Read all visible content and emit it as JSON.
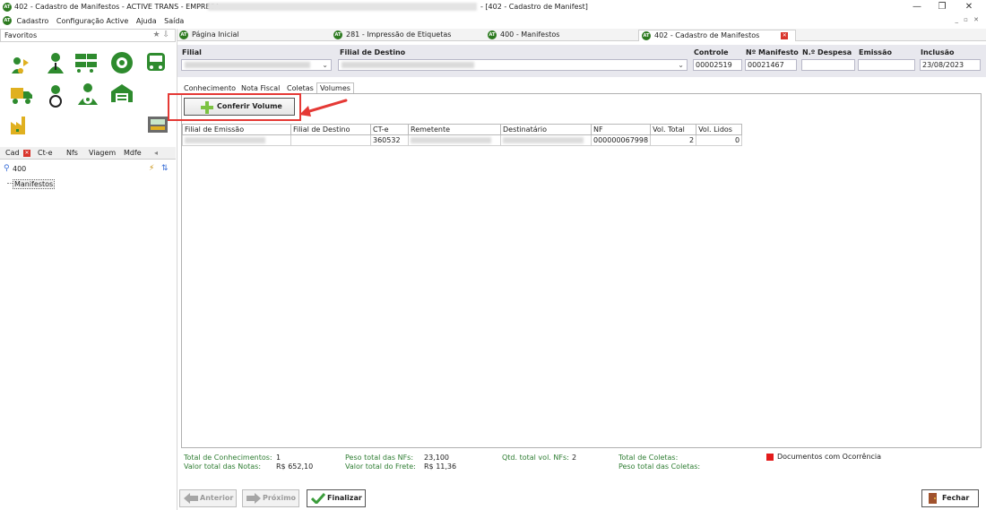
{
  "window": {
    "title_left": "402 - Cadastro de Manifestos - ACTIVE TRANS - EMPRESA:",
    "title_right": "- [402 - Cadastro de Manifest]"
  },
  "menu": {
    "items": [
      "Cadastro",
      "Configuração Active",
      "Ajuda",
      "Saída"
    ]
  },
  "left_panel": {
    "favorites_label": "Favoritos",
    "tabs": [
      "Cad",
      "Ct-e",
      "Nfs",
      "Viagem",
      "Mdfe"
    ],
    "search_value": "400",
    "tree_node": "Manifestos"
  },
  "doc_tabs": [
    {
      "label": "Página Inicial"
    },
    {
      "label": "281 - Impressão de Etiquetas"
    },
    {
      "label": "400 - Manifestos"
    },
    {
      "label": "402 - Cadastro de Manifestos"
    }
  ],
  "header": {
    "filial_label": "Filial",
    "filial_destino_label": "Filial de Destino",
    "controle_label": "Controle",
    "controle_value": "00002519",
    "manifesto_label": "Nº Manifesto",
    "manifesto_value": "00021467",
    "despesa_label": "N.º Despesa",
    "despesa_value": "",
    "emissao_label": "Emissão",
    "emissao_value": "",
    "inclusao_label": "Inclusão",
    "inclusao_value": "23/08/2023"
  },
  "inner_tabs": [
    "Conhecimento",
    "Nota Fiscal",
    "Coletas",
    "Volumes"
  ],
  "conferir_button": "Conferir Volume",
  "grid": {
    "columns": [
      "Filial de Emissão",
      "Filial de Destino",
      "CT-e",
      "Remetente",
      "Destinatário",
      "NF",
      "Vol. Total",
      "Vol. Lidos"
    ],
    "rows": [
      {
        "cte": "360532",
        "nf": "000000067998",
        "vol_total": "2",
        "vol_lidos": "0"
      }
    ]
  },
  "totals": {
    "conhecimentos_label": "Total de Conhecimentos:",
    "conhecimentos_value": "1",
    "valor_notas_label": "Valor total das Notas:",
    "valor_notas_value": "R$ 652,10",
    "peso_nfs_label": "Peso total das NFs:",
    "peso_nfs_value": "23,100",
    "valor_frete_label": "Valor total do Frete:",
    "valor_frete_value": "R$ 11,36",
    "qtd_vol_label": "Qtd. total vol. NFs:",
    "qtd_vol_value": "2",
    "coletas_label": "Total de Coletas:",
    "peso_coletas_label": "Peso total das Coletas:",
    "legend_label": "Documentos com Ocorrência"
  },
  "bottom": {
    "anterior": "Anterior",
    "proximo": "Próximo",
    "finalizar": "Finalizar",
    "fechar": "Fechar"
  },
  "colors": {
    "accent_green": "#2e7d32",
    "highlight_red": "#e53935",
    "legend_red": "#e31b1b"
  }
}
